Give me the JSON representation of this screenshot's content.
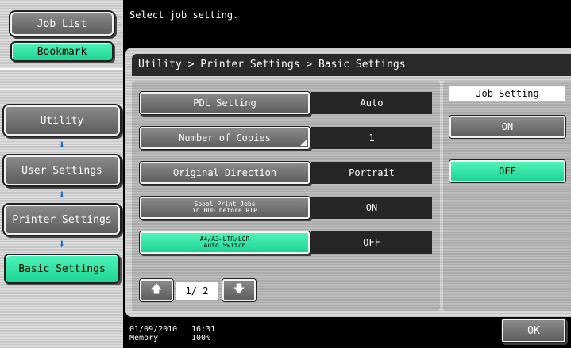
{
  "left_nav": {
    "job_list": "Job List",
    "bookmark": "Bookmark",
    "utility": "Utility",
    "user_settings": "User Settings",
    "printer_settings": "Printer Settings",
    "basic_settings": "Basic Settings",
    "arrow_glyph": "⬇"
  },
  "message": "Select job setting.",
  "breadcrumb": "Utility > Printer Settings > Basic Settings",
  "settings": [
    {
      "label": "PDL Setting",
      "value": "Auto"
    },
    {
      "label": "Number of Copies",
      "value": "1"
    },
    {
      "label": "Original Direction",
      "value": "Portrait"
    },
    {
      "label_line1": "Spool Print Jobs",
      "label_line2": "in HDD before RIP",
      "value": "ON"
    },
    {
      "label_line1": "A4/A3↔LTR/LGR",
      "label_line2": "Auto Switch",
      "value": "OFF"
    }
  ],
  "pagination": {
    "up": "🡅",
    "down": "🡇",
    "indicator": "1/ 2"
  },
  "job_setting": {
    "title": "Job Setting",
    "on": "ON",
    "off": "OFF"
  },
  "status": {
    "date": "01/09/2010",
    "time": "16:31",
    "memory_label": "Memory",
    "memory_value": "100%"
  },
  "ok": "OK",
  "colors": {
    "accent_green": "#2de3a0",
    "button_gray": "#6e6e6e",
    "panel_dark": "#262626"
  }
}
